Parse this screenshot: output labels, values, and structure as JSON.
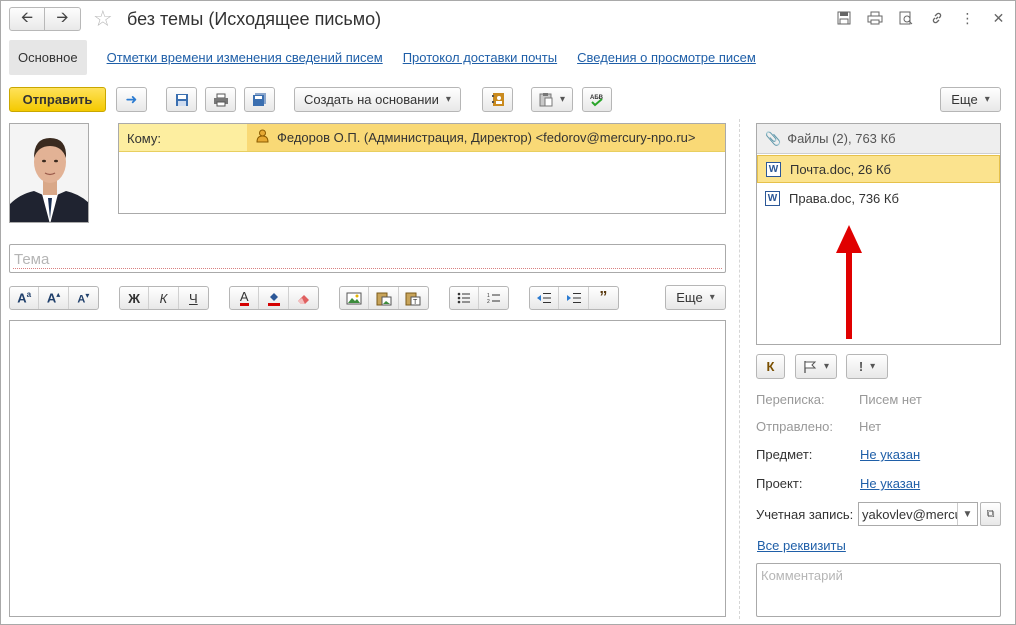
{
  "window": {
    "title": "без темы (Исходящее письмо)"
  },
  "tabs": [
    {
      "label": "Основное"
    },
    {
      "label": "Отметки времени изменения сведений писем"
    },
    {
      "label": "Протокол доставки почты"
    },
    {
      "label": "Сведения о просмотре писем"
    }
  ],
  "toolbar": {
    "send_label": "Отправить",
    "create_based_label": "Создать на основании",
    "more_label": "Еще"
  },
  "recipients": {
    "to_label": "Кому:",
    "to_value": "Федоров О.П. (Администрация, Директор) <fedorov@mercury-npo.ru>"
  },
  "subject": {
    "placeholder": "Тема",
    "value": ""
  },
  "format_toolbar": {
    "bold": "Ж",
    "italic": "К",
    "underline": "Ч",
    "more_label": "Еще"
  },
  "files": {
    "header": "Файлы (2), 763 Кб",
    "items": [
      {
        "name": "Почта.doc, 26 Кб",
        "selected": true
      },
      {
        "name": "Права.doc, 736 Кб",
        "selected": false
      }
    ]
  },
  "markers": {
    "k_label": "К",
    "important_label": "!"
  },
  "properties": {
    "thread_label": "Переписка:",
    "thread_value": "Писем нет",
    "sent_label": "Отправлено:",
    "sent_value": "Нет",
    "subject_label": "Предмет:",
    "subject_value": "Не указан",
    "project_label": "Проект:",
    "project_value": "Не указан",
    "account_label": "Учетная запись:",
    "account_value": "yakovlev@mercury-npo.ru",
    "all_details_link": "Все реквизиты"
  },
  "comment": {
    "placeholder": "Комментарий"
  },
  "colors": {
    "accent_yellow": "#f4c900",
    "highlight": "#fbe38e",
    "link": "#1f5fa8",
    "arrow": "#e00000"
  }
}
